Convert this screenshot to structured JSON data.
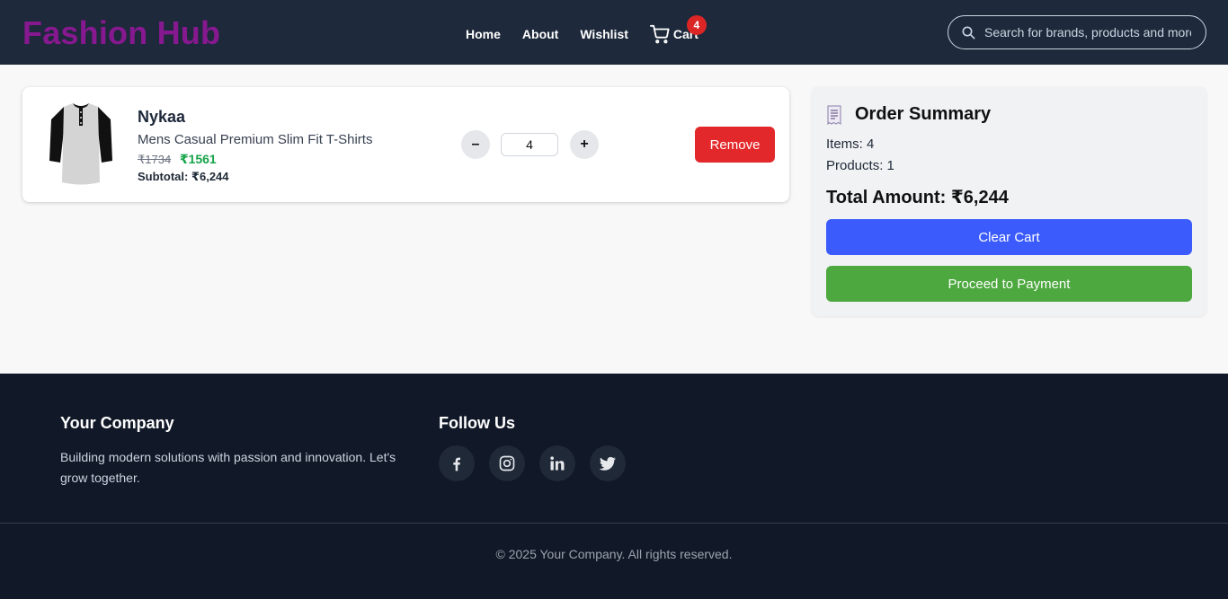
{
  "header": {
    "logo": "Fashion Hub",
    "nav": {
      "home": "Home",
      "about": "About",
      "wishlist": "Wishlist",
      "cart": "Cart",
      "cart_count": "4"
    },
    "search": {
      "placeholder": "Search for brands, products and more",
      "value": ""
    }
  },
  "cart_item": {
    "brand": "Nykaa",
    "name": "Mens Casual Premium Slim Fit T-Shirts",
    "original_price": "₹1734",
    "price": "₹1561",
    "subtotal": "Subtotal: ₹6,244",
    "quantity": "4",
    "minus_label": "–",
    "plus_label": "+",
    "remove_label": "Remove"
  },
  "summary": {
    "title": "Order Summary",
    "items": "Items: 4",
    "products": "Products: 1",
    "total": "Total Amount: ₹6,244",
    "clear_label": "Clear Cart",
    "pay_label": "Proceed to Payment"
  },
  "footer": {
    "company_title": "Your Company",
    "company_desc": "Building modern solutions with passion and innovation. Let's grow together.",
    "follow_title": "Follow Us",
    "socials": [
      "facebook-icon",
      "instagram-icon",
      "linkedin-icon",
      "twitter-icon"
    ],
    "copyright": "© 2025 Your Company. All rights reserved."
  },
  "colors": {
    "header_bg": "#1e293b",
    "logo": "#86198f",
    "badge": "#dc2626",
    "remove": "#e3282b",
    "clear": "#3b5bfd",
    "pay": "#4da83f",
    "price_green": "#16a34a",
    "footer_bg": "#111827"
  }
}
